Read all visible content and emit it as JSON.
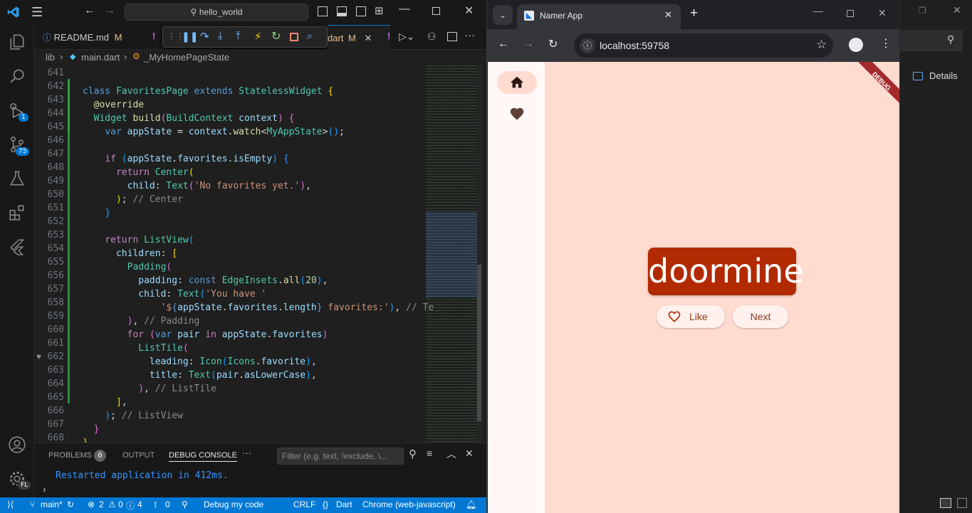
{
  "vscode": {
    "search_text": "hello_world",
    "tabs": [
      {
        "label": "README.md",
        "modified": "M"
      },
      {
        "label": "dart",
        "modified": "M"
      }
    ],
    "breadcrumb": [
      "lib",
      "main.dart",
      "_MyHomePageState"
    ],
    "activity_badges": {
      "debug": "1",
      "source_control": "75"
    },
    "account_badge": "FL",
    "panel": {
      "tabs": [
        "PROBLEMS",
        "OUTPUT",
        "DEBUG CONSOLE"
      ],
      "problems_count": "6",
      "filter_placeholder": "Filter (e.g. text, !exclude, \\...",
      "console_line": "Restarted application in 412ms.",
      "more": "···"
    },
    "status": {
      "branch": "main*",
      "errors": "2",
      "warnings": "0",
      "info": "4",
      "ports": "0",
      "debug": "Debug my code",
      "eol": "CRLF",
      "language": "Dart",
      "device": "Chrome (web-javascript)"
    },
    "line_numbers": [
      "641",
      "642",
      "643",
      "644",
      "645",
      "646",
      "647",
      "648",
      "649",
      "650",
      "651",
      "652",
      "653",
      "654",
      "655",
      "656",
      "657",
      "658",
      "659",
      "660",
      "661",
      "662",
      "663",
      "664",
      "665",
      "666",
      "667",
      "668"
    ]
  },
  "chrome": {
    "tab_title": "Namer App",
    "url": "localhost:59758"
  },
  "app": {
    "word": "doormine",
    "like_label": "Like",
    "next_label": "Next",
    "debug_banner": "DEBUG",
    "colors": {
      "background": "#ffdbd0",
      "card": "#b22a00",
      "rail": "#fff8f6"
    }
  },
  "side_panel": {
    "details_label": "Details"
  }
}
